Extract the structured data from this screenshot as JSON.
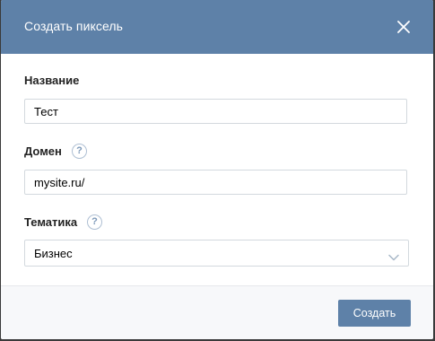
{
  "dialog": {
    "title": "Создать пиксель",
    "close_icon": "close-icon"
  },
  "form": {
    "name": {
      "label": "Название",
      "value": "Тест"
    },
    "domain": {
      "label": "Домен",
      "help_icon": "question-mark-icon",
      "help_glyph": "?",
      "value": "mysite.ru/"
    },
    "topic": {
      "label": "Тематика",
      "help_icon": "question-mark-icon",
      "help_glyph": "?",
      "selected": "Бизнес",
      "dropdown_icon": "chevron-down-icon"
    }
  },
  "footer": {
    "create_label": "Создать"
  },
  "colors": {
    "header_bg": "#5e81a8",
    "button_bg": "#5e81a8",
    "footer_bg": "#f7f8fa",
    "help_icon": "#7c98b8"
  }
}
